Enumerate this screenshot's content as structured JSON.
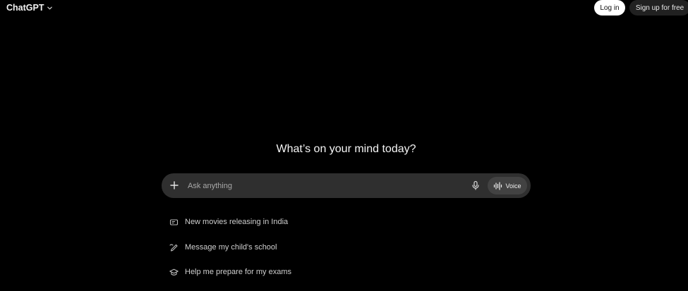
{
  "header": {
    "brand": "ChatGPT",
    "login_label": "Log in",
    "signup_label": "Sign up for free"
  },
  "main": {
    "headline": "What’s on your mind today?",
    "composer": {
      "placeholder": "Ask anything",
      "voice_label": "Voice"
    },
    "suggestions": [
      {
        "label": "New movies releasing in India",
        "icon": "ticket-icon"
      },
      {
        "label": "Message my child's school",
        "icon": "pen-icon"
      },
      {
        "label": "Help me prepare for my exams",
        "icon": "graduation-cap-icon"
      }
    ]
  },
  "colors": {
    "background": "#000000",
    "composer": "#2f2f2f",
    "voice_button": "#424242",
    "login_button": "#ffffff",
    "signup_button": "#212121"
  }
}
